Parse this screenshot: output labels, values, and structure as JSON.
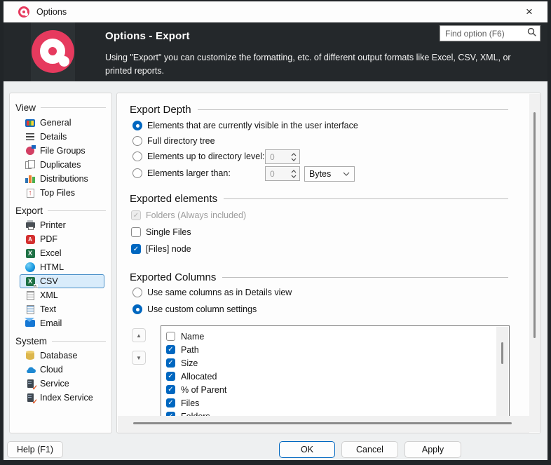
{
  "window": {
    "title": "Options",
    "close_glyph": "×"
  },
  "header": {
    "title": "Options - Export",
    "description": "Using \"Export\" you can customize the formatting, etc. of different output formats like Excel, CSV, XML, or printed reports.",
    "search_placeholder": "Find option (F6)"
  },
  "sidebar": {
    "selected_item": "CSV",
    "sections": [
      {
        "label": "View",
        "items": [
          {
            "label": "General",
            "icon": "general-icon"
          },
          {
            "label": "Details",
            "icon": "details-icon"
          },
          {
            "label": "File Groups",
            "icon": "file-groups-icon"
          },
          {
            "label": "Duplicates",
            "icon": "duplicates-icon"
          },
          {
            "label": "Distributions",
            "icon": "distributions-icon"
          },
          {
            "label": "Top Files",
            "icon": "top-files-icon"
          }
        ]
      },
      {
        "label": "Export",
        "items": [
          {
            "label": "Printer",
            "icon": "printer-icon"
          },
          {
            "label": "PDF",
            "icon": "pdf-icon"
          },
          {
            "label": "Excel",
            "icon": "excel-icon"
          },
          {
            "label": "HTML",
            "icon": "html-icon"
          },
          {
            "label": "CSV",
            "icon": "csv-icon",
            "selected": true
          },
          {
            "label": "XML",
            "icon": "xml-icon"
          },
          {
            "label": "Text",
            "icon": "text-icon"
          },
          {
            "label": "Email",
            "icon": "email-icon"
          }
        ]
      },
      {
        "label": "System",
        "items": [
          {
            "label": "Database",
            "icon": "database-icon"
          },
          {
            "label": "Cloud",
            "icon": "cloud-icon"
          },
          {
            "label": "Service",
            "icon": "service-icon"
          },
          {
            "label": "Index Service",
            "icon": "index-service-icon"
          }
        ]
      }
    ]
  },
  "content": {
    "export_depth": {
      "title": "Export Depth",
      "options": [
        {
          "label": "Elements that are currently visible in the user interface",
          "selected": true
        },
        {
          "label": "Full directory tree",
          "selected": false
        },
        {
          "label": "Elements up to directory level:",
          "selected": false,
          "value": "0"
        },
        {
          "label": "Elements larger than:",
          "selected": false,
          "value": "0",
          "unit": "Bytes"
        }
      ]
    },
    "exported_elements": {
      "title": "Exported elements",
      "checkboxes": [
        {
          "label": "Folders (Always included)",
          "checked": true,
          "disabled": true
        },
        {
          "label": "Single Files",
          "checked": false,
          "disabled": false
        },
        {
          "label": "[Files] node",
          "checked": true,
          "disabled": false
        }
      ]
    },
    "exported_columns": {
      "title": "Exported Columns",
      "options": [
        {
          "label": "Use same columns as in Details view",
          "selected": false
        },
        {
          "label": "Use custom column settings",
          "selected": true
        }
      ],
      "columns": [
        {
          "label": "Name",
          "checked": false
        },
        {
          "label": "Path",
          "checked": true
        },
        {
          "label": "Size",
          "checked": true
        },
        {
          "label": "Allocated",
          "checked": true
        },
        {
          "label": "% of Parent",
          "checked": true
        },
        {
          "label": "Files",
          "checked": true
        },
        {
          "label": "Folders",
          "checked": true
        }
      ]
    }
  },
  "footer": {
    "help": "Help (F1)",
    "ok": "OK",
    "cancel": "Cancel",
    "apply": "Apply"
  },
  "colors": {
    "accent": "#0067c0",
    "brand_pink": "#e63a5e",
    "header_bg": "#24282b",
    "selection_bg": "#d9ecfb",
    "selection_border": "#4a90c8"
  }
}
